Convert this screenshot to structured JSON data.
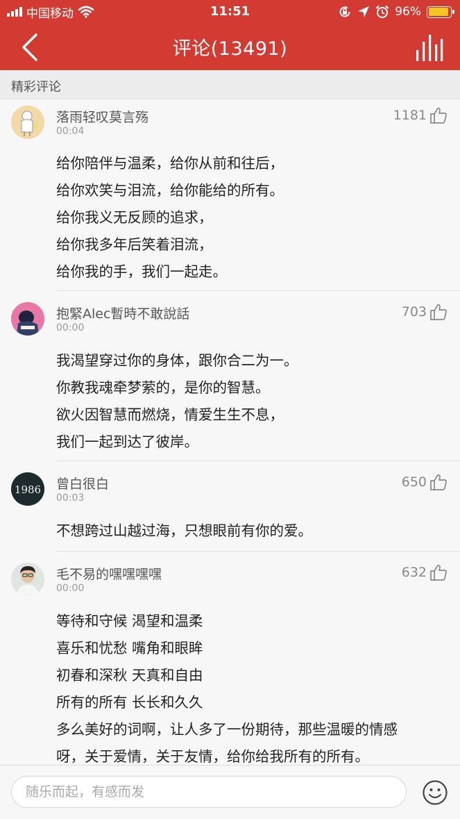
{
  "status_bar": {
    "carrier": "中国移动",
    "time": "11:51",
    "battery": "96%"
  },
  "nav": {
    "title": "评论(13491)"
  },
  "section": {
    "title": "精彩评论"
  },
  "colors": {
    "header_bg": "#d33a31",
    "battery_fill": "#f3c623"
  },
  "icons": [
    "back-arrow-icon",
    "chart-bars-icon",
    "wifi-icon",
    "lock-rotation-icon",
    "location-arrow-icon",
    "alarm-icon",
    "battery-icon",
    "thumbs-up-icon",
    "emoji-smile-icon"
  ],
  "comments": [
    {
      "username": "落雨轻叹莫言殇",
      "time": "00:04",
      "likes": "1181",
      "lines": [
        "给你陪伴与温柔，给你从前和往后，",
        "给你欢笑与泪流，给你能给的所有。",
        "给你我义无反顾的追求，",
        "给你我多年后笑着泪流，",
        "给你我的手，我们一起走。"
      ]
    },
    {
      "username": "抱緊Alec暫時不敢說話",
      "time": "00:00",
      "likes": "703",
      "lines": [
        "我渴望穿过你的身体，跟你合二为一。",
        "你教我魂牵梦萦的，是你的智慧。",
        "欲火因智慧而燃烧，情爱生生不息，",
        "我们一起到达了彼岸。"
      ]
    },
    {
      "username": "曾白很白",
      "time": "00:03",
      "likes": "650",
      "avatar_text": "1986",
      "lines": [
        "不想跨过山越过海，只想眼前有你的爱。"
      ]
    },
    {
      "username": "毛不易的嘿嘿嘿嘿",
      "time": "00:00",
      "likes": "632",
      "lines": [
        "等待和守候 渴望和温柔",
        "喜乐和忧愁 嘴角和眼眸",
        "初春和深秋 天真和自由",
        "所有的所有 长长和久久",
        "多么美好的词啊，让人多了一份期待，那些温暖的情感",
        "呀，关于爱情，关于友情，给你给我所有的所有。"
      ]
    }
  ],
  "input": {
    "placeholder": "随乐而起，有感而发"
  }
}
